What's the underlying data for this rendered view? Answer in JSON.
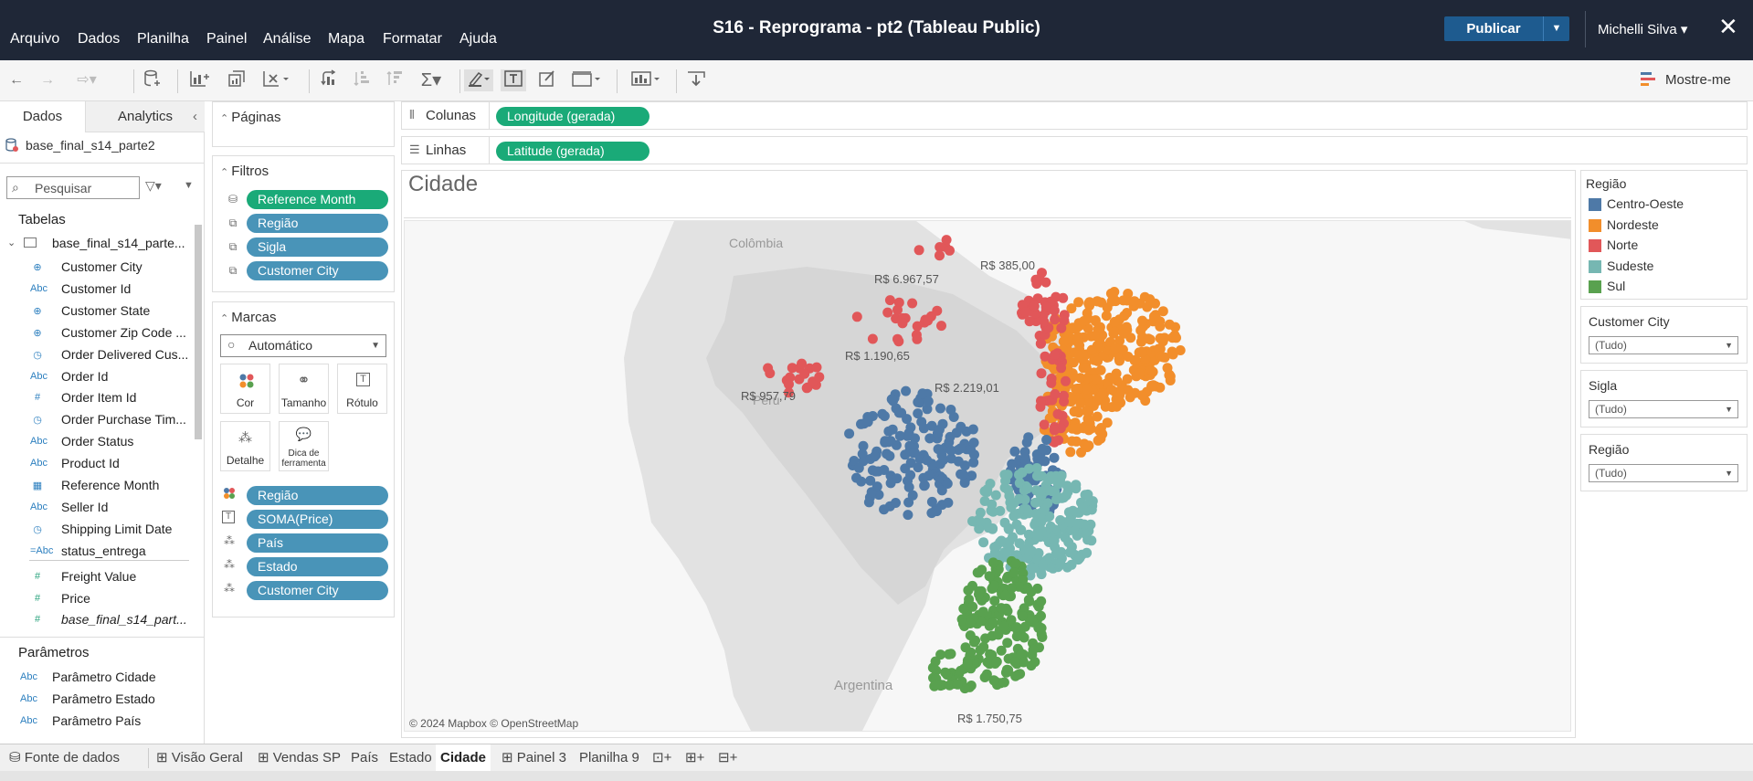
{
  "title_bar": {
    "menus": [
      "Arquivo",
      "Dados",
      "Planilha",
      "Painel",
      "Análise",
      "Mapa",
      "Formatar",
      "Ajuda"
    ],
    "workbook_title": "S16 - Reprograma - pt2 (Tableau Public)",
    "publish_label": "Publicar",
    "user_name": "Michelli Silva ▾",
    "close_glyph": "✕"
  },
  "toolbar": {
    "show_me_label": "Mostre-me"
  },
  "data_pane": {
    "tabs": [
      "Dados",
      "Analytics"
    ],
    "data_source": "base_final_s14_parte2",
    "search_placeholder": "Pesquisar",
    "tables_header": "Tabelas",
    "table_name": "base_final_s14_parte...",
    "fields": [
      {
        "icon": "globe-icon",
        "name": "Customer City",
        "kind": "dim"
      },
      {
        "icon": "abc-icon",
        "name": "Customer Id",
        "kind": "dim"
      },
      {
        "icon": "globe-icon",
        "name": "Customer State",
        "kind": "dim"
      },
      {
        "icon": "globe-icon",
        "name": "Customer Zip Code ...",
        "kind": "dim"
      },
      {
        "icon": "datetime-icon",
        "name": "Order Delivered Cus...",
        "kind": "dim"
      },
      {
        "icon": "abc-icon",
        "name": "Order Id",
        "kind": "dim"
      },
      {
        "icon": "hash-icon",
        "name": "Order Item Id",
        "kind": "dim"
      },
      {
        "icon": "datetime-icon",
        "name": "Order Purchase Tim...",
        "kind": "dim"
      },
      {
        "icon": "abc-icon",
        "name": "Order Status",
        "kind": "dim"
      },
      {
        "icon": "abc-icon",
        "name": "Product Id",
        "kind": "dim"
      },
      {
        "icon": "calendar-icon",
        "name": "Reference Month",
        "kind": "dim"
      },
      {
        "icon": "abc-icon",
        "name": "Seller Id",
        "kind": "dim"
      },
      {
        "icon": "datetime-icon",
        "name": "Shipping Limit Date",
        "kind": "dim"
      },
      {
        "icon": "calc-abc-icon",
        "name": "status_entrega",
        "kind": "dim"
      },
      {
        "icon": "hash-icon",
        "name": "Freight Value",
        "kind": "mea"
      },
      {
        "icon": "hash-icon",
        "name": "Price",
        "kind": "mea"
      },
      {
        "icon": "hash-icon",
        "name": "base_final_s14_part...",
        "kind": "mea"
      }
    ],
    "parameters_header": "Parâmetros",
    "parameters": [
      "Parâmetro Cidade",
      "Parâmetro Estado",
      "Parâmetro País"
    ]
  },
  "shelves": {
    "pages_label": "Páginas",
    "filters_label": "Filtros",
    "filters": [
      "Reference Month",
      "Região",
      "Sigla",
      "Customer City"
    ],
    "marks_label": "Marcas",
    "mark_type": "Automático",
    "mark_buttons": [
      "Cor",
      "Tamanho",
      "Rótulo",
      "Detalhe",
      "Dica de ferramenta"
    ],
    "mark_pills": [
      "Região",
      "SOMA(Price)",
      "País",
      "Estado",
      "Customer City"
    ],
    "columns_label": "Colunas",
    "columns_pill": "Longitude (gerada)",
    "rows_label": "Linhas",
    "rows_pill": "Latitude (gerada)"
  },
  "view": {
    "sheet_title": "Cidade",
    "map_countries": [
      "Colômbia",
      "Peru",
      "Argentina"
    ],
    "map_value_labels": [
      "R$ 6.967,57",
      "R$ 385,00",
      "R$ 1.190,65",
      "R$ 2.219,01",
      "R$ 957,79",
      "R$ 1.750,75"
    ],
    "attribution": "© 2024 Mapbox  © OpenStreetMap"
  },
  "legend": {
    "title": "Região",
    "items": [
      {
        "label": "Centro-Oeste",
        "color": "#4e79a7"
      },
      {
        "label": "Nordeste",
        "color": "#f28e2b"
      },
      {
        "label": "Norte",
        "color": "#e15759"
      },
      {
        "label": "Sudeste",
        "color": "#76b7b2"
      },
      {
        "label": "Sul",
        "color": "#59a14f"
      }
    ],
    "filter_cards": [
      {
        "title": "Customer City",
        "value": "(Tudo)"
      },
      {
        "title": "Sigla",
        "value": "(Tudo)"
      },
      {
        "title": "Região",
        "value": "(Tudo)"
      }
    ]
  },
  "bottom_tabs": {
    "data_source": "Fonte de dados",
    "sheets": [
      "Visão Geral",
      "Vendas SP",
      "País",
      "Estado",
      "Cidade",
      "Painel 3",
      "Planilha 9"
    ],
    "active": "Cidade"
  }
}
